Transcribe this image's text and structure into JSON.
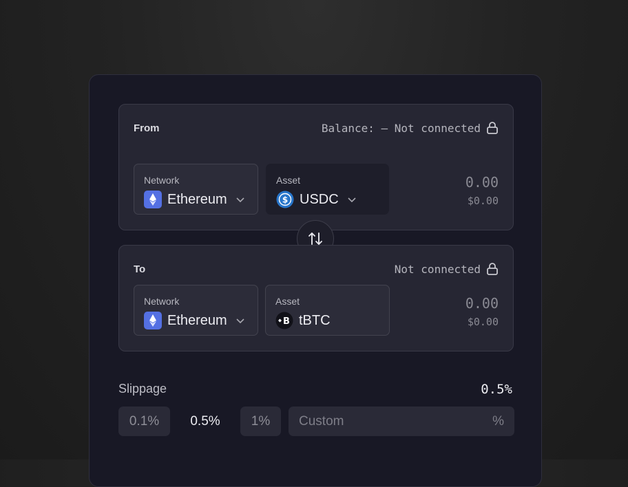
{
  "from": {
    "title": "From",
    "status": "Balance: – Not connected",
    "network": {
      "label": "Network",
      "value": "Ethereum"
    },
    "asset": {
      "label": "Asset",
      "value": "USDC"
    },
    "amount": "0.00",
    "usd": "$0.00"
  },
  "to": {
    "title": "To",
    "status": "Not connected",
    "network": {
      "label": "Network",
      "value": "Ethereum"
    },
    "asset": {
      "label": "Asset",
      "value": "tBTC"
    },
    "amount": "0.00",
    "usd": "$0.00"
  },
  "slippage": {
    "label": "Slippage",
    "value": "0.5%",
    "options": [
      "0.1%",
      "0.5%",
      "1%"
    ],
    "selected": "0.5%",
    "custom_placeholder": "Custom",
    "custom_unit": "%"
  },
  "colors": {
    "card_bg": "#181825",
    "panel_bg": "#262633",
    "ethereum": "#5470e3",
    "usdc": "#2775ca"
  },
  "icons": {
    "lock": "lock-icon",
    "ethereum": "ethereum-icon",
    "usdc": "usdc-icon",
    "tbtc": "tbtc-icon",
    "chevron": "chevron-down-icon",
    "swap": "swap-arrows-icon"
  }
}
